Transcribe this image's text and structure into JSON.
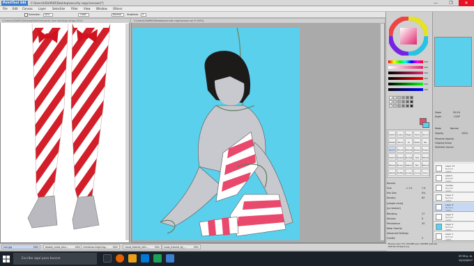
{
  "app": {
    "logo": "PaintTool SAI",
    "title": "C:\\Users\\USUARIO\\Desktop\\security copy\\raccoon(*) ",
    "window_controls": [
      "—",
      "❐",
      "✕"
    ]
  },
  "menu": [
    "File",
    "Edit",
    "Canvas",
    "Layer",
    "Selection",
    "Filter",
    "View",
    "Window",
    "Others"
  ],
  "toolbar": {
    "selection_label": "Selection",
    "zoom": "50%",
    "angle": "+000°",
    "mode": "Normal",
    "stabilizer_label": "Stabilizer",
    "stabilizer_value": "3"
  },
  "left_window": {
    "path": "C:\\Users\\USUARIO\\Desktop\\Sketches\\candy cane stockings ref.jpg (50%)"
  },
  "right_window": {
    "path": "C:\\Users\\USUARIO\\Desktop\\security copy\\raccoon.sai (*) (50%)"
  },
  "color_sliders": [
    {
      "label": "H",
      "value": "228",
      "color": "#e34"
    },
    {
      "label": "S",
      "value": "190",
      "color": "#888"
    },
    {
      "label": "V",
      "value": "190",
      "color": "#444"
    },
    {
      "label": "R",
      "value": "183",
      "color": "#e44"
    },
    {
      "label": "G",
      "value": "142",
      "color": "#4c4"
    },
    {
      "label": "B",
      "value": "190",
      "color": "#44e"
    }
  ],
  "tools": [
    "Select",
    "Lasso",
    "Magic Wand",
    "Hand",
    "Zoom",
    "Rotate",
    "Move",
    "Air Brush",
    "Water Color",
    "Pen",
    "Pencil",
    "Brush",
    "Marker",
    "Binary",
    "Eraser",
    "Select",
    "Deselect",
    "Bucket",
    "Text",
    "Marker",
    "Ellipse",
    "Binary",
    "Watercolor",
    "Blur",
    "Blender",
    "Stamp",
    "Halftone",
    "Lineart",
    "Curve",
    "Color"
  ],
  "nav": {
    "zoom_label": "Zoom",
    "zoom": "50.0%",
    "angle_label": "Angle",
    "angle": "+000°"
  },
  "layer_panel": {
    "mode_label": "Mode",
    "mode": "Normal",
    "opacity_label": "Opacity",
    "opacity": "100%",
    "preserve": "Preserve Opacity",
    "clipping": "Clipping Group",
    "selection_source": "Selection Source",
    "layers": [
      {
        "name": "Layer 13",
        "mode": "Normal",
        "opacity": "100%"
      },
      {
        "name": "sketch",
        "mode": "Normal",
        "opacity": "100%"
      },
      {
        "name": "medias",
        "mode": "Normal",
        "opacity": "100%"
      },
      {
        "name": "Layer 3",
        "mode": "Normal",
        "opacity": "100%"
      },
      {
        "name": "Layer 9",
        "mode": "Normal",
        "opacity": "100%"
      },
      {
        "name": "Layer 5",
        "mode": "Normal",
        "opacity": "100%"
      },
      {
        "name": "Layer 4",
        "mode": "Normal",
        "opacity": "100%"
      },
      {
        "name": "Layer 1",
        "mode": "Normal",
        "opacity": "100%"
      }
    ]
  },
  "brush_props": {
    "mode": "Normal",
    "size_label": "Size",
    "size_mult": "x 1.0",
    "size": "7.0",
    "min_size_label": "Min Size",
    "min_size": "0%",
    "density_label": "Density",
    "density": "63",
    "shape": "[simple circle]",
    "texture": "[no texture]",
    "blending_label": "Blending",
    "blending": "17",
    "dilution_label": "Dilution",
    "dilution": "0",
    "persistence_label": "Persistence",
    "persistence": "55",
    "keep_opacity": "Keep Opacity",
    "advanced": "Advanced Settings",
    "quality_label": "Quality",
    "quality": "2",
    "edge_label": "Edge Hardness",
    "edge": "0",
    "min_density_label": "Min Density",
    "min_density": "0"
  },
  "tabs": [
    {
      "label": "nax.jpg",
      "zoom": "50%"
    },
    {
      "label": "bloody_snow_tuto...",
      "zoom": "50%"
    },
    {
      "label": "christmas-thigh-hig...",
      "zoom": "50%"
    },
    {
      "label": "cloud_tutorial_refe...",
      "zoom": "50%"
    },
    {
      "label": "snow_tutorial_by_...",
      "zoom": "50%"
    }
  ],
  "status": {
    "memory": "Memory load: 57% (3674MB used / 9624MB reserved)",
    "used": "Shift Ctrl Alt Space Any"
  },
  "taskbar": {
    "search_placeholder": "Escribe aquí para buscar",
    "time": "07:55 p. m.",
    "date": "12/12/2017"
  }
}
